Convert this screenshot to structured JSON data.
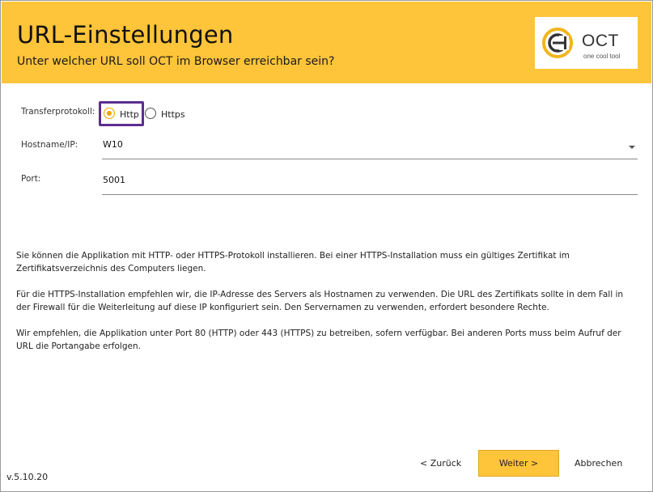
{
  "header": {
    "title": "URL-Einstellungen",
    "subtitle": "Unter welcher URL soll OCT im Browser erreichbar sein?",
    "logo_text": "OCT",
    "logo_sub": "one cool tool",
    "background": "#fec43a"
  },
  "form": {
    "protocol_label": "Transferprotokoll:",
    "protocol_options": [
      "Http",
      "Https"
    ],
    "protocol_selected": "Http",
    "hostname_label": "Hostname/IP:",
    "hostname_value": "W10",
    "port_label": "Port:",
    "port_value": "5001"
  },
  "info": {
    "paragraph_1": "Sie können die Applikation mit HTTP- oder HTTPS-Protokoll installieren. Bei einer HTTPS-Installation muss ein gültiges Zertifikat im Zertifikatsverzeichnis des Computers liegen.",
    "paragraph_2": "Für die HTTPS-Installation empfehlen wir, die IP-Adresse des Servers als Hostnamen zu verwenden. Die URL des Zertifikats sollte in dem Fall in der Firewall für die Weiterleitung auf diese IP konfiguriert sein. Den Servernamen zu verwenden, erfordert besondere Rechte.",
    "paragraph_3": "Wir empfehlen, die Applikation unter Port 80 (HTTP) oder 443 (HTTPS) zu betreiben, sofern verfügbar. Bei anderen Ports muss beim Aufruf der URL die Portangabe erfolgen."
  },
  "buttons": {
    "back": "< Zurück",
    "next": "Weiter >",
    "cancel": "Abbrechen"
  },
  "footer": {
    "version": "v.5.10.20"
  },
  "colors": {
    "accent": "#fec43a",
    "focus": "#5c2d91",
    "radio_selected": "#f0a400"
  }
}
